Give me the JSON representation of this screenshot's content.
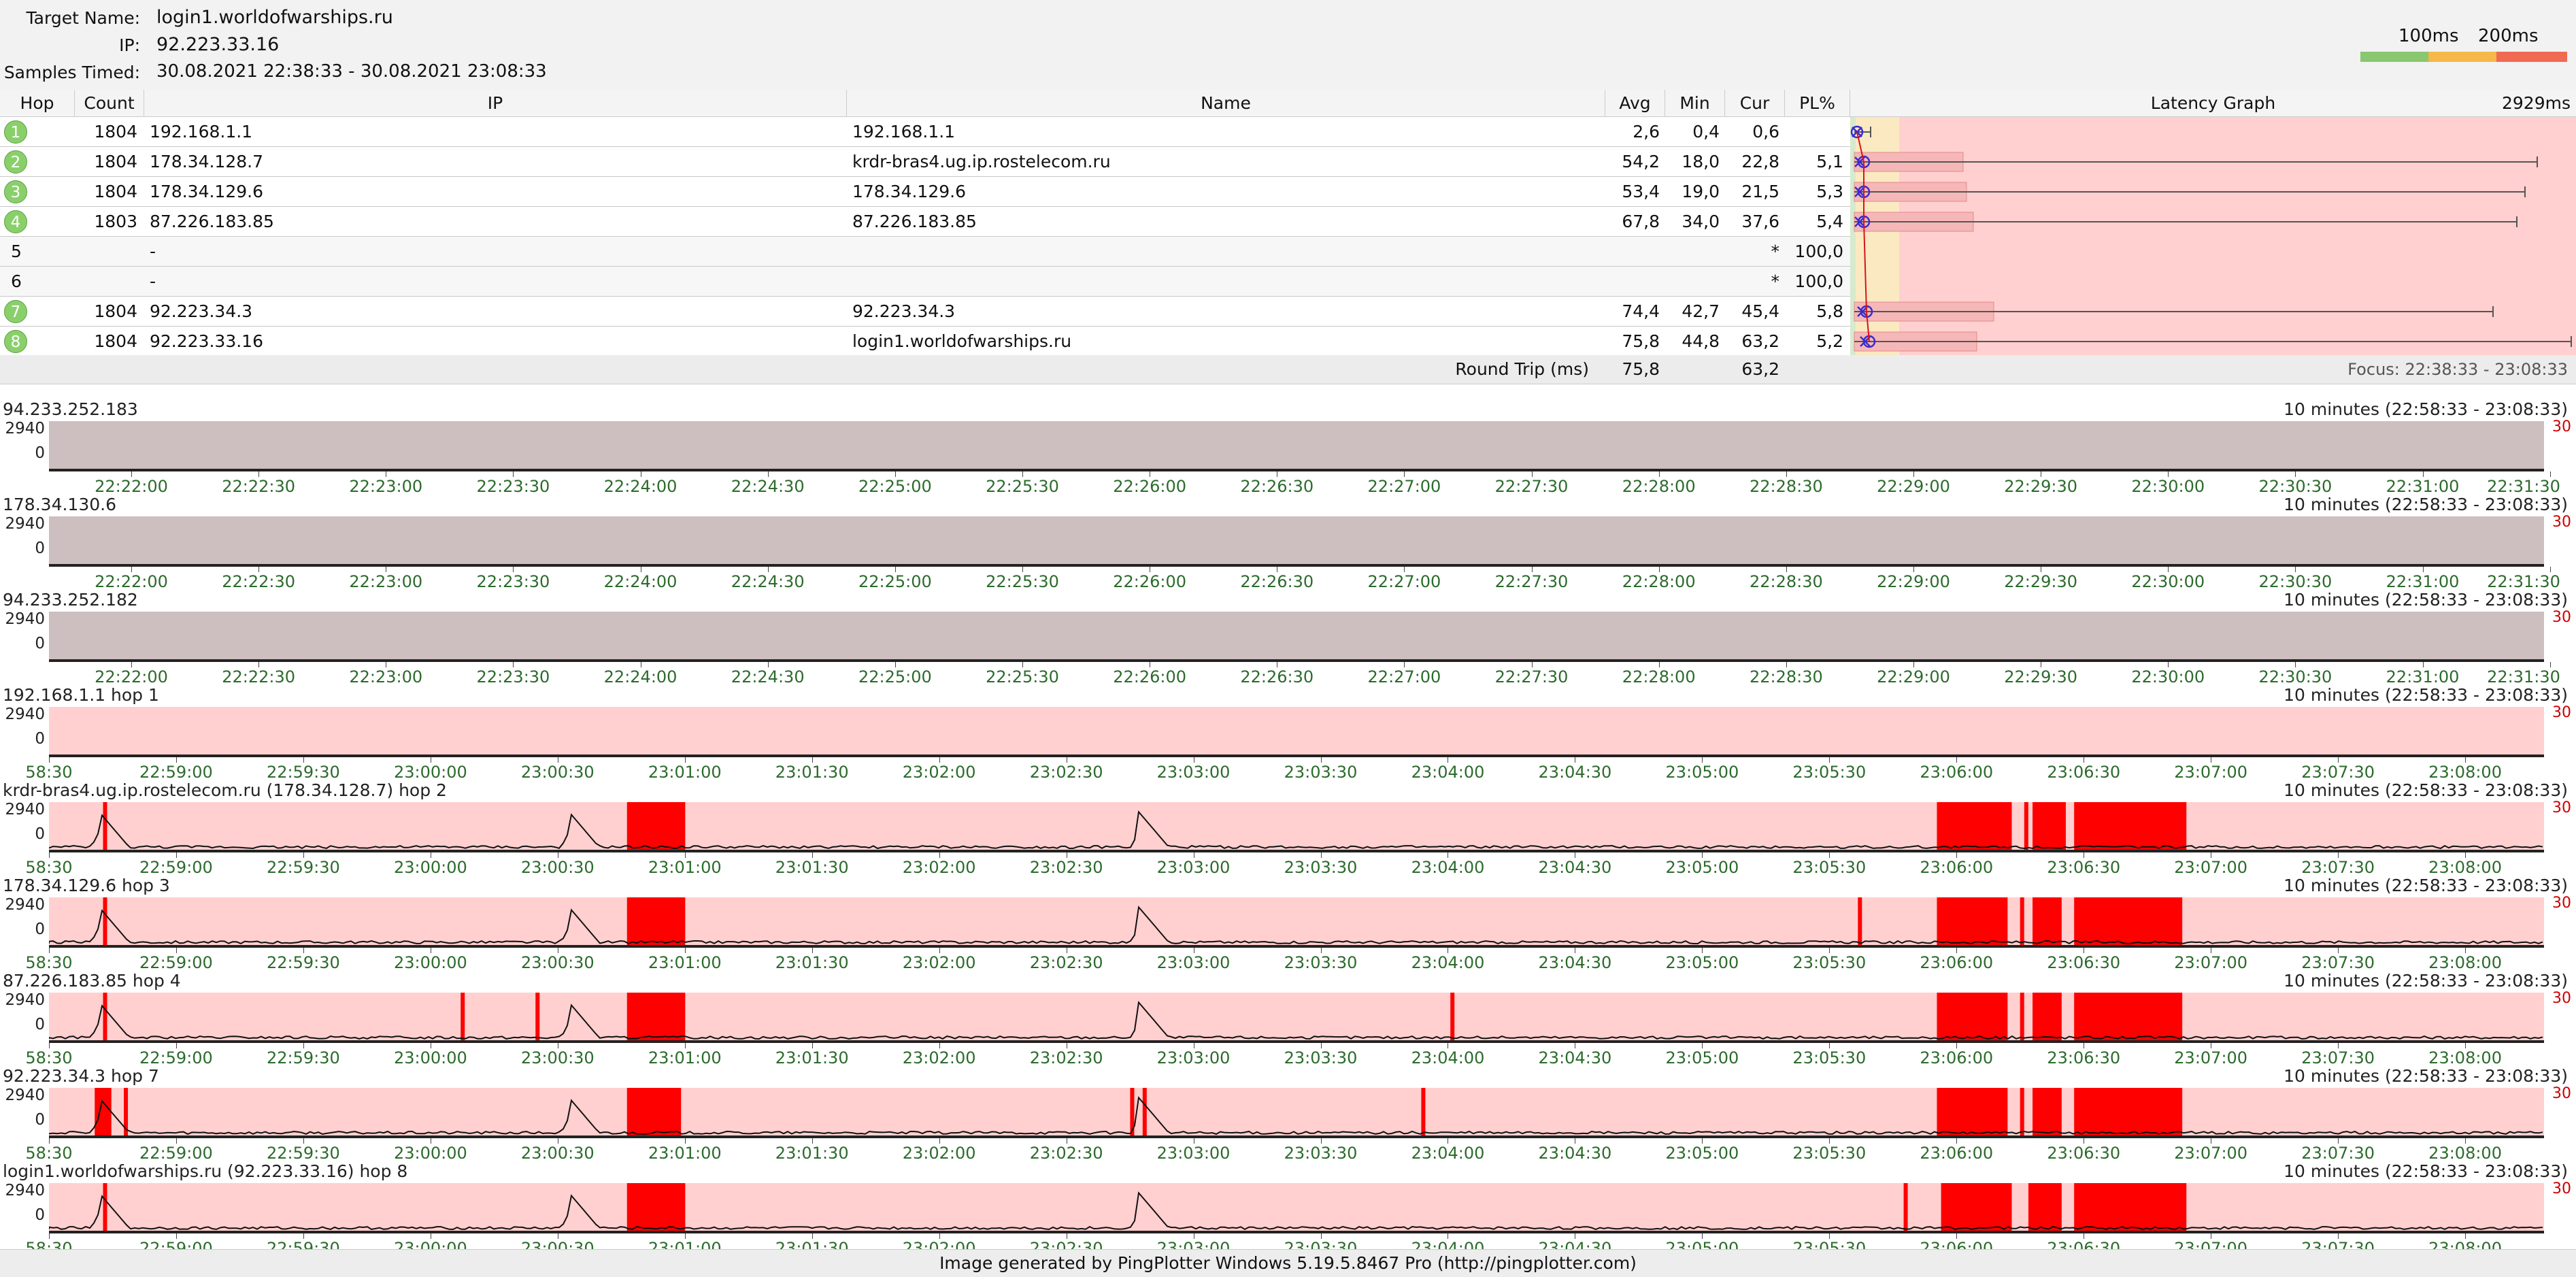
{
  "header": {
    "target_label": "Target Name:",
    "target_value": "login1.worldofwarships.ru",
    "ip_label": "IP:",
    "ip_value": "92.223.33.16",
    "samples_label": "Samples Timed:",
    "samples_value": "30.08.2021 22:38:33 - 30.08.2021 23:08:33",
    "legend_100": "100ms",
    "legend_200": "200ms",
    "legend_colors": [
      "#8ac76f",
      "#f5b84a",
      "#f06a52"
    ]
  },
  "table": {
    "columns": {
      "hop": "Hop",
      "count": "Count",
      "ip": "IP",
      "name": "Name",
      "avg": "Avg",
      "min": "Min",
      "cur": "Cur",
      "pl": "PL%",
      "latency": "Latency Graph",
      "latency_max": "2929ms"
    },
    "rows": [
      {
        "hop": "1",
        "count": "1804",
        "ip": "192.168.1.1",
        "name": "192.168.1.1",
        "avg": "2,6",
        "min": "0,4",
        "cur": "0,6",
        "pl": "",
        "responding": true
      },
      {
        "hop": "2",
        "count": "1804",
        "ip": "178.34.128.7",
        "name": "krdr-bras4.ug.ip.rostelecom.ru",
        "avg": "54,2",
        "min": "18,0",
        "cur": "22,8",
        "pl": "5,1",
        "responding": true
      },
      {
        "hop": "3",
        "count": "1804",
        "ip": "178.34.129.6",
        "name": "178.34.129.6",
        "avg": "53,4",
        "min": "19,0",
        "cur": "21,5",
        "pl": "5,3",
        "responding": true
      },
      {
        "hop": "4",
        "count": "1803",
        "ip": "87.226.183.85",
        "name": "87.226.183.85",
        "avg": "67,8",
        "min": "34,0",
        "cur": "37,6",
        "pl": "5,4",
        "responding": true
      },
      {
        "hop": "5",
        "count": "",
        "ip": "-",
        "name": "",
        "avg": "",
        "min": "",
        "cur": "*",
        "pl": "100,0",
        "responding": false
      },
      {
        "hop": "6",
        "count": "",
        "ip": "-",
        "name": "",
        "avg": "",
        "min": "",
        "cur": "*",
        "pl": "100,0",
        "responding": false
      },
      {
        "hop": "7",
        "count": "1804",
        "ip": "92.223.34.3",
        "name": "92.223.34.3",
        "avg": "74,4",
        "min": "42,7",
        "cur": "45,4",
        "pl": "5,8",
        "responding": true
      },
      {
        "hop": "8",
        "count": "1804",
        "ip": "92.223.33.16",
        "name": "login1.worldofwarships.ru",
        "avg": "75,8",
        "min": "44,8",
        "cur": "63,2",
        "pl": "5,2",
        "responding": true
      }
    ],
    "round_trip_label": "Round Trip (ms)",
    "round_trip_avg": "75,8",
    "round_trip_cur": "63,2",
    "focus": "Focus: 22:38:33 - 23:08:33"
  },
  "graphs": [
    {
      "title": "94.233.252.183",
      "range": "10 minutes (22:58:33 - 23:08:33)",
      "y_max": "2940",
      "y_min": "0",
      "y_right": "30",
      "kind": "timeout",
      "ticks": [
        "22:22:00",
        "22:22:30",
        "22:23:00",
        "22:23:30",
        "22:24:00",
        "22:24:30",
        "22:25:00",
        "22:25:30",
        "22:26:00",
        "22:26:30",
        "22:27:00",
        "22:27:30",
        "22:28:00",
        "22:28:30",
        "22:29:00",
        "22:29:30",
        "22:30:00",
        "22:30:30",
        "22:31:00",
        "22:31:30"
      ]
    },
    {
      "title": "178.34.130.6",
      "range": "10 minutes (22:58:33 - 23:08:33)",
      "y_max": "2940",
      "y_min": "0",
      "y_right": "30",
      "kind": "timeout",
      "ticks": [
        "22:22:00",
        "22:22:30",
        "22:23:00",
        "22:23:30",
        "22:24:00",
        "22:24:30",
        "22:25:00",
        "22:25:30",
        "22:26:00",
        "22:26:30",
        "22:27:00",
        "22:27:30",
        "22:28:00",
        "22:28:30",
        "22:29:00",
        "22:29:30",
        "22:30:00",
        "22:30:30",
        "22:31:00",
        "22:31:30"
      ]
    },
    {
      "title": "94.233.252.182",
      "range": "10 minutes (22:58:33 - 23:08:33)",
      "y_max": "2940",
      "y_min": "0",
      "y_right": "30",
      "kind": "timeout",
      "ticks": [
        "22:22:00",
        "22:22:30",
        "22:23:00",
        "22:23:30",
        "22:24:00",
        "22:24:30",
        "22:25:00",
        "22:25:30",
        "22:26:00",
        "22:26:30",
        "22:27:00",
        "22:27:30",
        "22:28:00",
        "22:28:30",
        "22:29:00",
        "22:29:30",
        "22:30:00",
        "22:30:30",
        "22:31:00",
        "22:31:30"
      ]
    },
    {
      "title": "192.168.1.1 hop 1",
      "range": "10 minutes (22:58:33 - 23:08:33)",
      "y_max": "2940",
      "y_min": "0",
      "y_right": "30",
      "kind": "flat",
      "ticks": [
        "58:30",
        "22:59:00",
        "22:59:30",
        "23:00:00",
        "23:00:30",
        "23:01:00",
        "23:01:30",
        "23:02:00",
        "23:02:30",
        "23:03:00",
        "23:03:30",
        "23:04:00",
        "23:04:30",
        "23:05:00",
        "23:05:30",
        "23:06:00",
        "23:06:30",
        "23:07:00",
        "23:07:30",
        "23:08:00"
      ]
    },
    {
      "title": "krdr-bras4.ug.ip.rostelecom.ru (178.34.128.7) hop 2",
      "range": "10 minutes (22:58:33 - 23:08:33)",
      "y_max": "2940",
      "y_min": "0",
      "y_right": "30",
      "kind": "hop",
      "loss": [
        "22:58:46",
        [
          "23:00:52",
          "23:01:06"
        ],
        [
          "23:06:07",
          "23:06:25"
        ],
        "23:06:28",
        [
          "23:06:30",
          "23:06:38"
        ],
        [
          "23:06:40",
          "23:07:07"
        ]
      ],
      "spikes": [
        "22:58:45",
        "23:00:38",
        "23:02:55"
      ],
      "ticks": [
        "58:30",
        "22:59:00",
        "22:59:30",
        "23:00:00",
        "23:00:30",
        "23:01:00",
        "23:01:30",
        "23:02:00",
        "23:02:30",
        "23:03:00",
        "23:03:30",
        "23:04:00",
        "23:04:30",
        "23:05:00",
        "23:05:30",
        "23:06:00",
        "23:06:30",
        "23:07:00",
        "23:07:30",
        "23:08:00",
        "23:0"
      ]
    },
    {
      "title": "178.34.129.6 hop 3",
      "range": "10 minutes (22:58:33 - 23:08:33)",
      "y_max": "2940",
      "y_min": "0",
      "y_right": "30",
      "kind": "hop",
      "loss": [
        "22:58:46",
        [
          "23:00:52",
          "23:01:06"
        ],
        "23:05:48",
        [
          "23:06:07",
          "23:06:24"
        ],
        "23:06:27",
        [
          "23:06:30",
          "23:06:37"
        ],
        [
          "23:06:40",
          "23:07:06"
        ]
      ],
      "spikes": [
        "22:58:45",
        "23:00:38",
        "23:02:55"
      ],
      "ticks": [
        "58:30",
        "22:59:00",
        "22:59:30",
        "23:00:00",
        "23:00:30",
        "23:01:00",
        "23:01:30",
        "23:02:00",
        "23:02:30",
        "23:03:00",
        "23:03:30",
        "23:04:00",
        "23:04:30",
        "23:05:00",
        "23:05:30",
        "23:06:00",
        "23:06:30",
        "23:07:00",
        "23:07:30",
        "23:08:00",
        "23:0"
      ]
    },
    {
      "title": "87.226.183.85 hop 4",
      "range": "10 minutes (22:58:33 - 23:08:33)",
      "y_max": "2940",
      "y_min": "0",
      "y_right": "30",
      "kind": "hop",
      "loss": [
        "22:58:46",
        "23:00:12",
        "23:00:30",
        [
          "23:00:52",
          "23:01:06"
        ],
        "23:04:10",
        [
          "23:06:07",
          "23:06:24"
        ],
        "23:06:27",
        [
          "23:06:30",
          "23:06:37"
        ],
        [
          "23:06:40",
          "23:07:06"
        ]
      ],
      "spikes": [
        "22:58:45",
        "23:00:38",
        "23:02:55"
      ],
      "ticks": [
        "58:30",
        "22:59:00",
        "22:59:30",
        "23:00:00",
        "23:00:30",
        "23:01:00",
        "23:01:30",
        "23:02:00",
        "23:02:30",
        "23:03:00",
        "23:03:30",
        "23:04:00",
        "23:04:30",
        "23:05:00",
        "23:05:30",
        "23:06:00",
        "23:06:30",
        "23:07:00",
        "23:07:30",
        "23:08:00",
        "23:0"
      ]
    },
    {
      "title": "92.223.34.3 hop 7",
      "range": "10 minutes (22:58:33 - 23:08:33)",
      "y_max": "2940",
      "y_min": "0",
      "y_right": "30",
      "kind": "hop",
      "loss": [
        [
          "22:58:44",
          "22:58:48"
        ],
        "22:58:51",
        [
          "23:00:52",
          "23:01:05"
        ],
        "23:02:53",
        "23:02:56",
        "23:04:03",
        [
          "23:06:07",
          "23:06:24"
        ],
        "23:06:27",
        [
          "23:06:30",
          "23:06:37"
        ],
        [
          "23:06:40",
          "23:07:06"
        ]
      ],
      "spikes": [
        "22:58:45",
        "23:00:38",
        "23:02:55"
      ],
      "ticks": [
        "58:30",
        "22:59:00",
        "22:59:30",
        "23:00:00",
        "23:00:30",
        "23:01:00",
        "23:01:30",
        "23:02:00",
        "23:02:30",
        "23:03:00",
        "23:03:30",
        "23:04:00",
        "23:04:30",
        "23:05:00",
        "23:05:30",
        "23:06:00",
        "23:06:30",
        "23:07:00",
        "23:07:30",
        "23:08:00",
        "23:0"
      ]
    },
    {
      "title": "login1.worldofwarships.ru (92.223.33.16) hop 8",
      "range": "10 minutes (22:58:33 - 23:08:33)",
      "y_max": "2940",
      "y_min": "0",
      "y_right": "30",
      "kind": "hop",
      "loss": [
        "22:58:46",
        [
          "23:00:52",
          "23:01:06"
        ],
        "23:05:59",
        [
          "23:06:08",
          "23:06:25"
        ],
        [
          "23:06:29",
          "23:06:37"
        ],
        [
          "23:06:40",
          "23:07:07"
        ]
      ],
      "spikes": [
        "22:58:45",
        "23:00:38",
        "23:02:55"
      ],
      "ticks": [
        "58:30",
        "22:59:00",
        "22:59:30",
        "23:00:00",
        "23:00:30",
        "23:01:00",
        "23:01:30",
        "23:02:00",
        "23:02:30",
        "23:03:00",
        "23:03:30",
        "23:04:00",
        "23:04:30",
        "23:05:00",
        "23:05:30",
        "23:06:00",
        "23:06:30",
        "23:07:00",
        "23:07:30",
        "23:08:00",
        "23:0"
      ]
    }
  ],
  "footer": "Image generated by PingPlotter Windows 5.19.5.8467 Pro (http://pingplotter.com)"
}
